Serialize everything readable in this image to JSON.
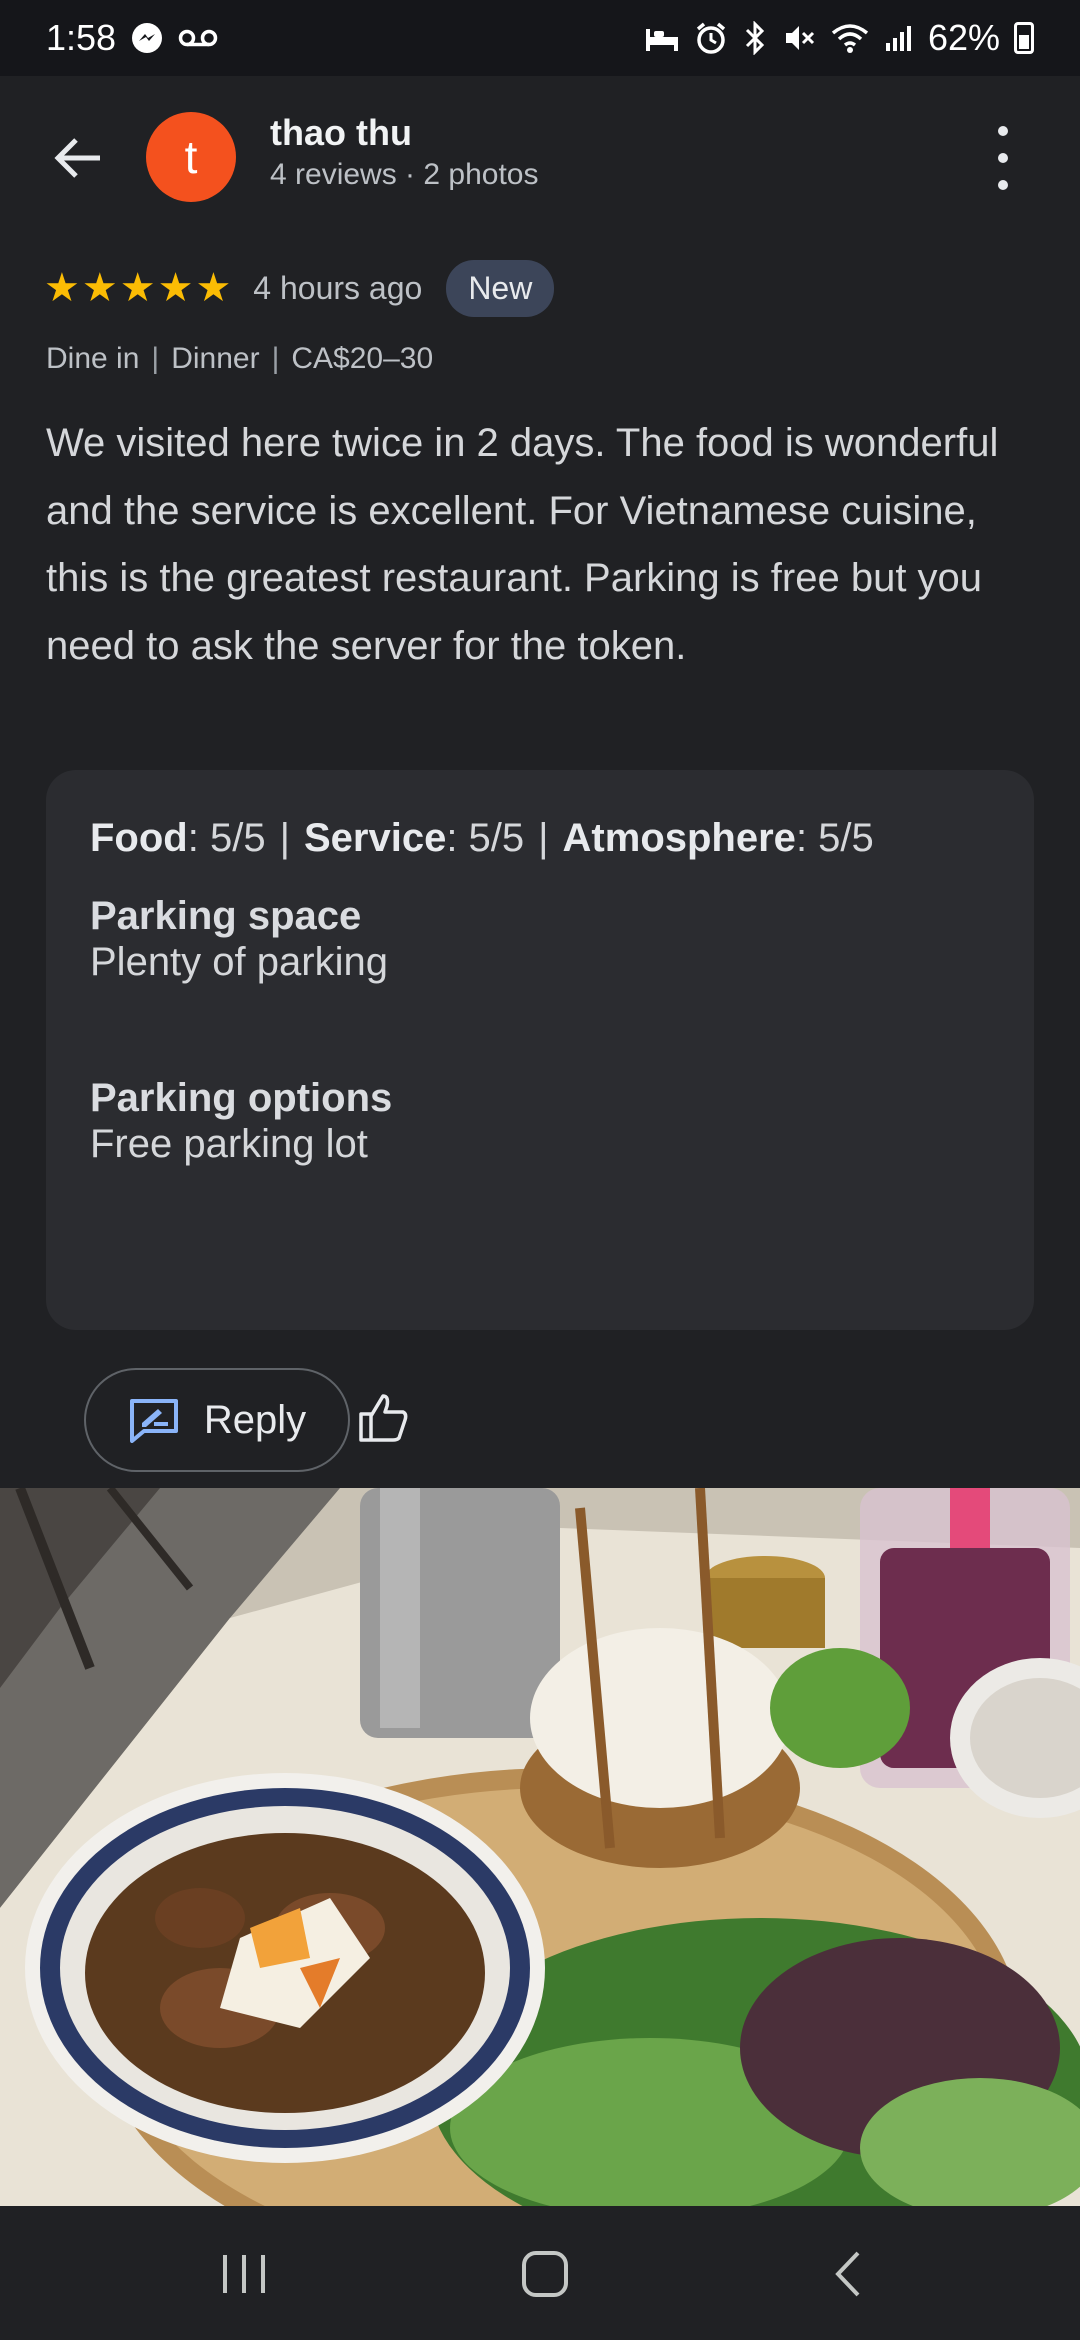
{
  "status_bar": {
    "time": "1:58",
    "battery": "62%",
    "icons": [
      "messenger-icon",
      "voicemail-icon",
      "sleep-icon",
      "alarm-icon",
      "bluetooth-icon",
      "mute-icon",
      "wifi-icon",
      "signal-icon",
      "battery-icon"
    ]
  },
  "header": {
    "avatar_letter": "t",
    "user_name": "thao thu",
    "user_meta": "4 reviews · 2 photos",
    "avatar_color": "#f4511e"
  },
  "review": {
    "stars": 5,
    "time": "4 hours ago",
    "badge": "New",
    "dine_type": "Dine in",
    "meal": "Dinner",
    "price": "CA$20–30",
    "text": "We visited here twice in 2 days. The food is wonderful and the service is excellent. For Vietnamese cuisine, this is the greatest restaurant. Parking is free but you need to ask the server for the token."
  },
  "attributes": {
    "scores": [
      {
        "label": "Food",
        "value": ": 5/5"
      },
      {
        "label": "Service",
        "value": ": 5/5"
      },
      {
        "label": "Atmosphere",
        "value": ": 5/5"
      }
    ],
    "parking_space_title": "Parking space",
    "parking_space_value": "Plenty of parking",
    "parking_options_title": "Parking options",
    "parking_options_value": "Free parking lot"
  },
  "actions": {
    "reply_label": "Reply"
  },
  "colors": {
    "background": "#202124",
    "card": "#2b2c30",
    "star": "#fbbc04",
    "badge": "#3c4559",
    "reply_icon": "#8ab4f8"
  }
}
